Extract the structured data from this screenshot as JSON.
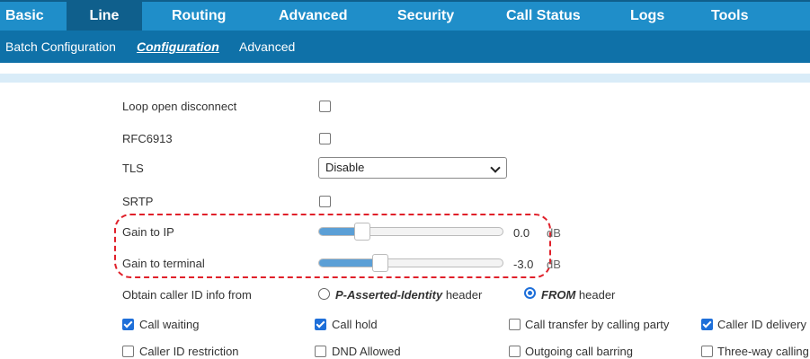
{
  "nav": {
    "tabs": [
      {
        "label": "Basic"
      },
      {
        "label": "Line"
      },
      {
        "label": "Routing"
      },
      {
        "label": "Advanced"
      },
      {
        "label": "Security"
      },
      {
        "label": "Call Status"
      },
      {
        "label": "Logs"
      },
      {
        "label": "Tools"
      }
    ],
    "subtabs": [
      {
        "label": "Batch Configuration"
      },
      {
        "label": "Configuration"
      },
      {
        "label": "Advanced"
      }
    ]
  },
  "settings": {
    "loop_open_disconnect": {
      "label": "Loop open disconnect",
      "checked": false
    },
    "rfc6913": {
      "label": "RFC6913",
      "checked": false
    },
    "tls": {
      "label": "TLS",
      "value": "Disable"
    },
    "srtp": {
      "label": "SRTP",
      "checked": false
    },
    "gain_to_ip": {
      "label": "Gain to IP",
      "value": "0.0",
      "unit": "dB",
      "level": 0.2
    },
    "gain_to_terminal": {
      "label": "Gain to terminal",
      "value": "-3.0",
      "unit": "dB",
      "level": 0.3
    },
    "caller_id_source": {
      "label": "Obtain caller ID info from",
      "option_pai": {
        "name": "P-Asserted-Identity",
        "suffix": "header",
        "selected": false
      },
      "option_from": {
        "name": "FROM",
        "suffix": "header",
        "selected": true
      }
    }
  },
  "features": {
    "row1": [
      {
        "label": "Call waiting",
        "checked": true
      },
      {
        "label": "Call hold",
        "checked": true
      },
      {
        "label": "Call transfer by calling party",
        "checked": false
      },
      {
        "label": "Caller ID delivery",
        "checked": true
      }
    ],
    "row2": [
      {
        "label": "Caller ID restriction",
        "checked": false
      },
      {
        "label": "DND Allowed",
        "checked": false
      },
      {
        "label": "Outgoing call barring",
        "checked": false
      },
      {
        "label": "Three-way calling",
        "checked": false
      }
    ]
  },
  "colors": {
    "nav_bg": "#1f8ec9",
    "nav_active": "#0f5f8c",
    "subnav_bg": "#0f71a8",
    "checkbox_checked": "#1e6fd9",
    "slider_fill": "#5b9fd6",
    "highlight": "#e0202a"
  }
}
